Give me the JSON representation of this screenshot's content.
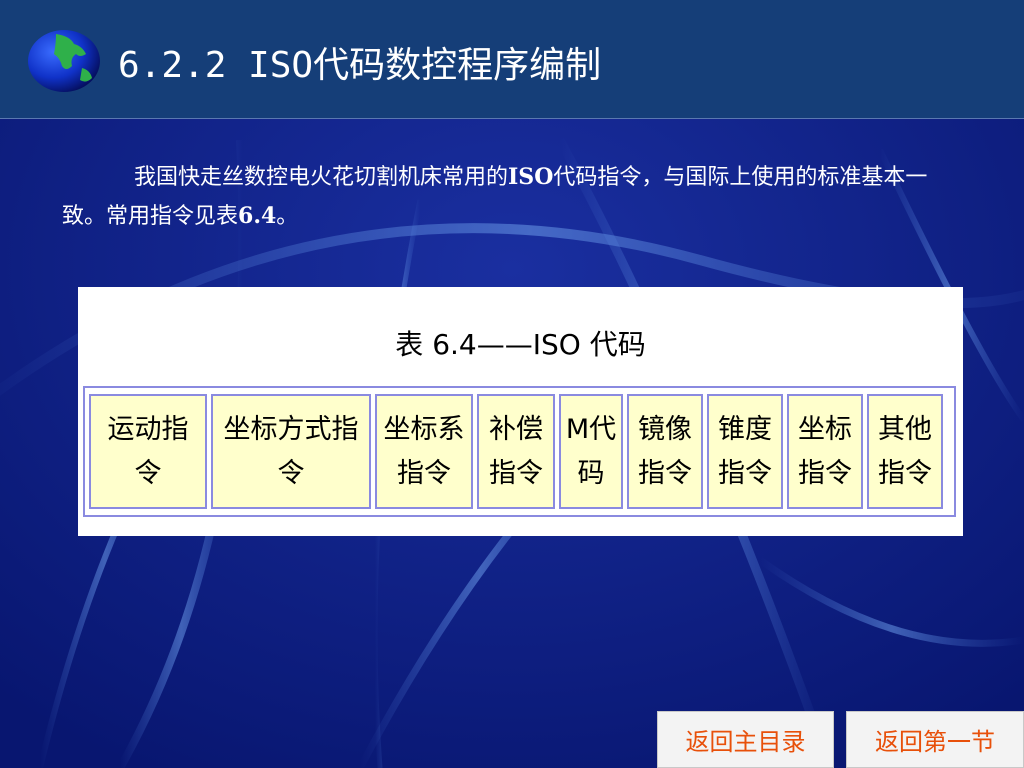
{
  "title": "6.2.2 ISO代码数控程序编制",
  "paragraph": {
    "part1": "我国快走丝数控电火花切割机床常用的",
    "iso": "ISO",
    "part2": "代码指令，与国际上使用的标准基本一致。常用指令见表",
    "ref": "6.4",
    "part3": "。"
  },
  "table": {
    "caption": "表 6.4——ISO 代码",
    "cells": [
      "运动指令",
      "坐标方式指令",
      "坐标系指令",
      "补偿指令",
      "M代码",
      "镜像指令",
      "锥度指令",
      "坐标指令",
      "其他指令"
    ]
  },
  "nav": {
    "main_menu": "返回主目录",
    "first_section": "返回第一节"
  },
  "colors": {
    "background": "#0c1f86",
    "header": "#153e78",
    "cell_fill": "#ffffcc",
    "nav_text": "#e8500a"
  }
}
